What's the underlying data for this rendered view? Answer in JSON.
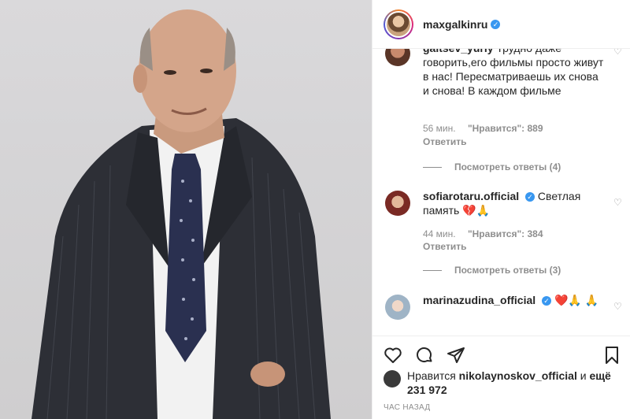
{
  "post": {
    "author": "maxgalkinru",
    "photo_alt_icon": "portrait-photo"
  },
  "comments": [
    {
      "user": "gaitsev_yuriy",
      "text": "Трудно даже говорить,его фильмы просто живут в нас! Пересматриваешь их снова и снова! В каждом фильме",
      "time": "56 мин.",
      "likes": "\"Нравится\": 889",
      "reply": "Ответить",
      "view_replies": "Посмотреть ответы (4)"
    },
    {
      "user": "sofiarotaru.official",
      "text": "Светлая память 💔🙏",
      "time": "44 мин.",
      "likes": "\"Нравится\": 384",
      "reply": "Ответить",
      "view_replies": "Посмотреть ответы (3)"
    },
    {
      "user": "marinazudina_official",
      "text": "❤️🙏 🙏"
    }
  ],
  "liked_by": {
    "prefix": "Нравится",
    "user": "nikolaynoskov_official",
    "joiner": "и",
    "more": "ещё 231 972"
  },
  "timestamp": "ЧАС НАЗАД",
  "colors": {
    "verified": "#3897f0",
    "secondary_text": "#8e8e8e",
    "primary_text": "#262626"
  }
}
